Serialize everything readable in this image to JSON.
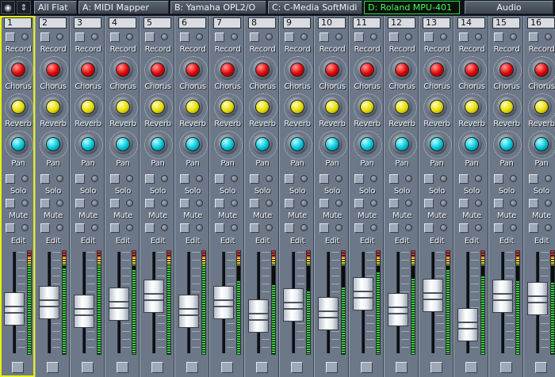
{
  "toolbar": {
    "icons": [
      "camera-icon",
      "arrows-icon"
    ],
    "buttons": [
      {
        "label": "All Flat",
        "active": false
      },
      {
        "label": "A: MIDI Mapper",
        "active": false
      },
      {
        "label": "B: Yamaha OPL2/O",
        "active": false
      },
      {
        "label": "C: C-Media SoftMidi",
        "active": false
      },
      {
        "label": "D: Roland MPU-401",
        "active": true
      },
      {
        "label": "Audio",
        "active": false
      }
    ]
  },
  "labels": {
    "record": "Record",
    "chorus": "Chorus",
    "reverb": "Reverb",
    "pan": "Pan",
    "solo": "Solo",
    "mute": "Mute",
    "edit": "Edit"
  },
  "channels": [
    {
      "number": "1",
      "fader_level": 0.42,
      "meter_level": 0.9,
      "selected": true
    },
    {
      "number": "2",
      "fader_level": 0.5,
      "meter_level": 0.82,
      "selected": false
    },
    {
      "number": "3",
      "fader_level": 0.38,
      "meter_level": 0.86,
      "selected": false
    },
    {
      "number": "4",
      "fader_level": 0.48,
      "meter_level": 0.8,
      "selected": false
    },
    {
      "number": "5",
      "fader_level": 0.58,
      "meter_level": 0.84,
      "selected": false
    },
    {
      "number": "6",
      "fader_level": 0.38,
      "meter_level": 0.88,
      "selected": false
    },
    {
      "number": "7",
      "fader_level": 0.5,
      "meter_level": 0.7,
      "selected": false
    },
    {
      "number": "8",
      "fader_level": 0.32,
      "meter_level": 0.66,
      "selected": false
    },
    {
      "number": "9",
      "fader_level": 0.47,
      "meter_level": 0.6,
      "selected": false
    },
    {
      "number": "10",
      "fader_level": 0.35,
      "meter_level": 0.64,
      "selected": false
    },
    {
      "number": "11",
      "fader_level": 0.62,
      "meter_level": 0.78,
      "selected": false
    },
    {
      "number": "12",
      "fader_level": 0.4,
      "meter_level": 0.72,
      "selected": false
    },
    {
      "number": "13",
      "fader_level": 0.6,
      "meter_level": 0.8,
      "selected": false
    },
    {
      "number": "14",
      "fader_level": 0.2,
      "meter_level": 0.74,
      "selected": false
    },
    {
      "number": "15",
      "fader_level": 0.58,
      "meter_level": 0.7,
      "selected": false
    },
    {
      "number": "16",
      "fader_level": 0.55,
      "meter_level": 0.68,
      "selected": false
    }
  ],
  "colors": {
    "record_knob": "#e00000",
    "chorus_knob": "#e6dc00",
    "reverb_knob": "#00c4d8",
    "active_tab": "#3cff55",
    "selection_outline": "#e6f20a"
  }
}
